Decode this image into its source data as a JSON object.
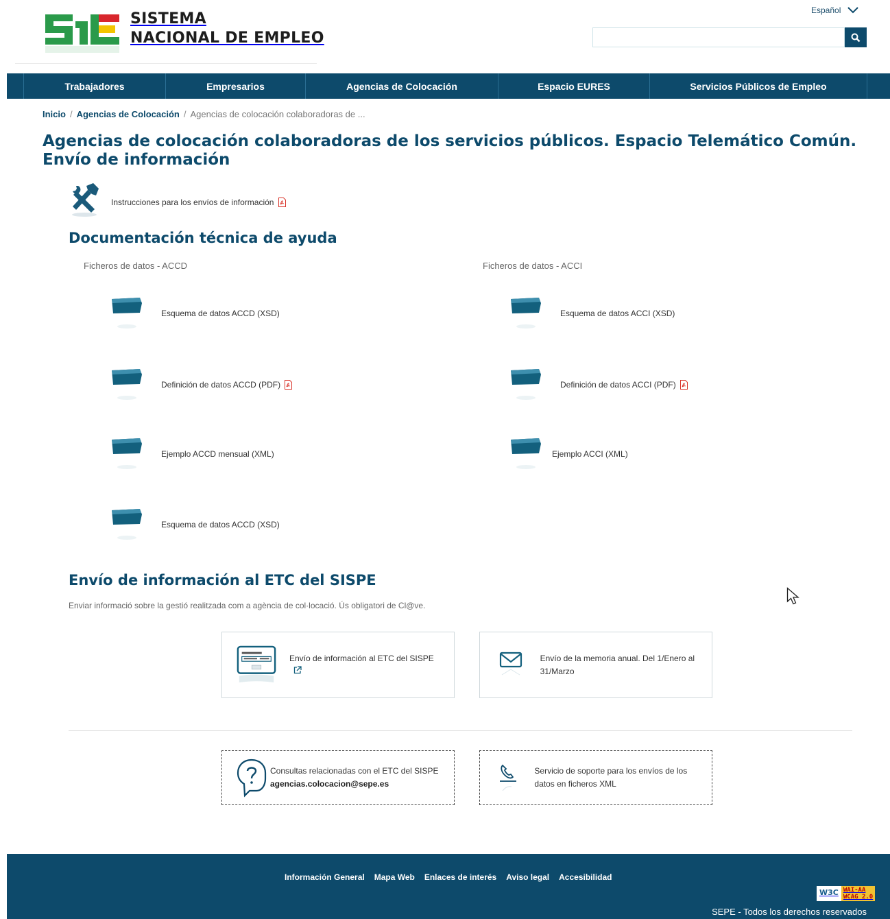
{
  "header": {
    "logo_line1": "SISTEMA",
    "logo_line2": "NACIONAL DE EMPLEO",
    "language": "Español",
    "search_placeholder": "",
    "search_icon": "search-icon"
  },
  "nav": {
    "items": [
      {
        "label": "Trabajadores"
      },
      {
        "label": "Empresarios"
      },
      {
        "label": "Agencias de Colocación"
      },
      {
        "label": "Espacio EURES"
      },
      {
        "label": "Servicios Públicos de Empleo"
      }
    ]
  },
  "breadcrumb": {
    "home": "Inicio",
    "parent": "Agencias de Colocación",
    "current": "Agencias de colocación colaboradoras de ..."
  },
  "page": {
    "title": "Agencias de colocación colaboradoras de los servicios públicos. Espacio Telemático Común. Envío de información",
    "instructions_link": "Instrucciones para los envíos de información"
  },
  "documentation": {
    "title": "Documentación técnica de ayuda",
    "accd": {
      "label": "Ficheros de datos - ACCD",
      "items": [
        {
          "label": "Esquema de datos ACCD (XSD)",
          "pdf": false
        },
        {
          "label": "Definición de datos ACCD (PDF)",
          "pdf": true
        },
        {
          "label": "Ejemplo ACCD mensual (XML)",
          "pdf": false
        },
        {
          "label": "Esquema de datos ACCD (XSD)",
          "pdf": false
        }
      ]
    },
    "acci": {
      "label": "Ficheros de datos - ACCI",
      "items": [
        {
          "label": "Esquema de datos ACCI (XSD)",
          "pdf": false
        },
        {
          "label": "Definición de datos ACCI (PDF)",
          "pdf": true
        },
        {
          "label": "Ejemplo ACCI (XML)",
          "pdf": false
        }
      ]
    }
  },
  "etc": {
    "title": "Envío de información al ETC del SISPE",
    "description": "Enviar informació sobre la gestió realitzada com a agència de col·locació. Ús obligatori de Cl@ve.",
    "cards": [
      {
        "label": "Envío de información al ETC del SISPE"
      },
      {
        "label": "Envío de la memoria anual. Del 1/Enero al 31/Marzo"
      }
    ],
    "support": [
      {
        "label": "Consultas relacionadas con el ETC del SISPE",
        "email": "agencias.colocacion@sepe.es"
      },
      {
        "label": "Servicio de soporte para los envíos de los datos en ficheros XML"
      }
    ]
  },
  "footer": {
    "links": [
      {
        "label": "Información General"
      },
      {
        "label": "Mapa Web"
      },
      {
        "label": "Enlaces de interés"
      },
      {
        "label": "Aviso legal"
      },
      {
        "label": "Accesibilidad"
      }
    ],
    "badge_w3c": "W3C",
    "badge_wai": "WAI-AA",
    "badge_wcag": "WCAG 2.0",
    "copyright": "SEPE - Todos los derechos reservados"
  },
  "colors": {
    "primary": "#0d4a6b",
    "logo_green": "#2a9a4a",
    "logo_yellow": "#f2c400",
    "logo_red": "#d8262c",
    "pdf_red": "#d9342b"
  }
}
